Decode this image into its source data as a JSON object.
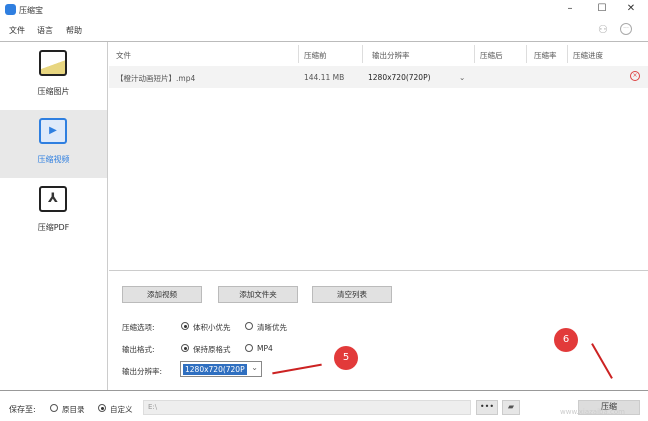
{
  "app": {
    "title": "压缩宝"
  },
  "menu": [
    "文件",
    "语言",
    "帮助"
  ],
  "window_controls": {
    "minimize": "–",
    "maximize": "☐",
    "close": "✕"
  },
  "sidebar": [
    {
      "label": "压缩图片",
      "icon": "image-icon"
    },
    {
      "label": "压缩视频",
      "icon": "video-icon",
      "selected": true
    },
    {
      "label": "压缩PDF",
      "icon": "pdf-icon"
    }
  ],
  "table": {
    "headers": [
      "文件",
      "压缩前",
      "输出分辨率",
      "压缩后",
      "压缩率",
      "压缩进度"
    ],
    "rows": [
      {
        "file": "【橙汁动画短片】.mp4",
        "before": "144.11 MB",
        "resolution": "1280x720(720P)",
        "after": "",
        "ratio": "",
        "progress": ""
      }
    ]
  },
  "buttons": {
    "add_video": "添加视频",
    "add_folder": "添加文件夹",
    "clear_list": "清空列表",
    "browse": "•••",
    "compress": "压缩"
  },
  "options": {
    "compress_label": "压缩选项:",
    "compress_opts": [
      "体积小优先",
      "清晰优先"
    ],
    "format_label": "输出格式:",
    "format_opts": [
      "保持原格式",
      "MP4"
    ],
    "resolution_label": "输出分辨率:",
    "resolution_value": "1280x720(720P"
  },
  "save": {
    "label": "保存至:",
    "opts": [
      "原目录",
      "自定义"
    ],
    "path": "E:\\"
  },
  "annotations": [
    "5",
    "6"
  ],
  "watermark": "下载吧 www.xiazaiba.com"
}
